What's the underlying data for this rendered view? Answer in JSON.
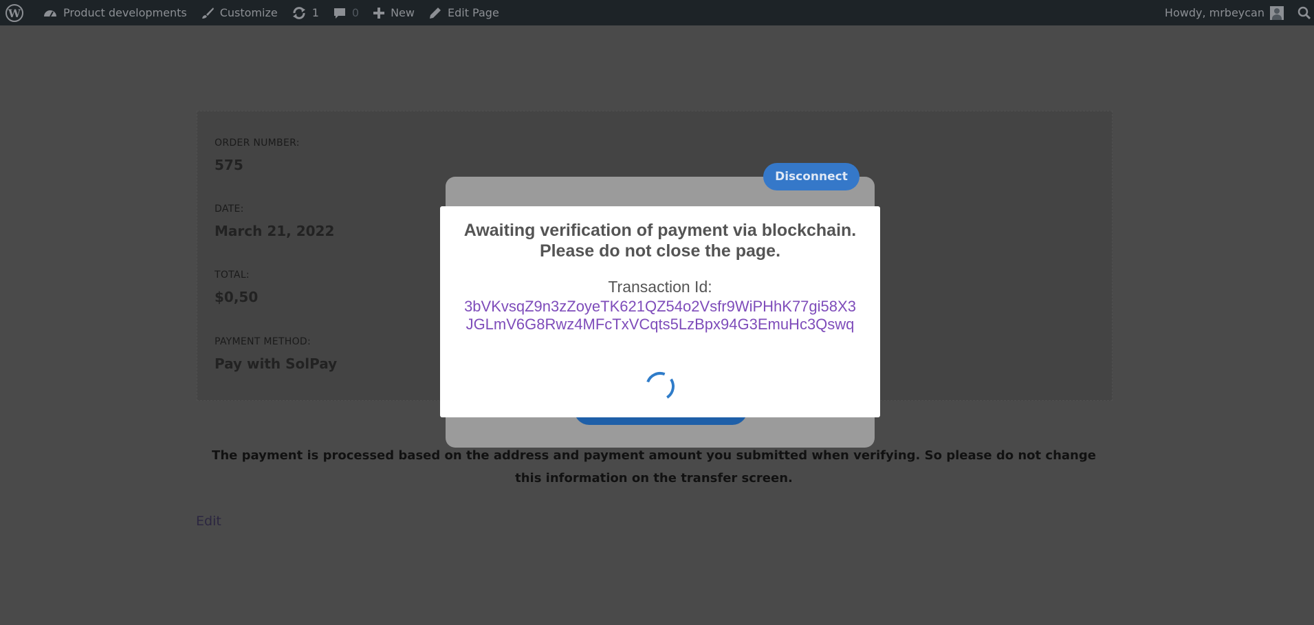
{
  "admin_bar": {
    "site_name": "Product developments",
    "customize": "Customize",
    "updates_count": "1",
    "comments_count": "0",
    "new": "New",
    "edit_page": "Edit Page",
    "howdy": "Howdy, mrbeycan"
  },
  "order": {
    "number_label": "ORDER NUMBER:",
    "number_value": "575",
    "date_label": "DATE:",
    "date_value": "March 21, 2022",
    "total_label": "TOTAL:",
    "total_value": "$0,50",
    "method_label": "PAYMENT METHOD:",
    "method_value": "Pay with SolPay"
  },
  "notice": "The payment is processed based on the address and payment amount you submitted when verifying. So please do not change this information on the transfer screen.",
  "edit_link": "Edit",
  "connect_modal": {
    "disconnect_label": "Disconnect"
  },
  "verify_modal": {
    "title": "Awaiting verification of payment via blockchain. Please do not close the page.",
    "txid_label": "Transaction Id:",
    "txid_value": "3bVKvsqZ9n3zZoyeTK621QZ54o2Vsfr9WiPHhK77gi58X3JGLmV6G8Rwz4MFcTxVCqts5LzBpx94G3EmuHc3Qswq"
  },
  "colors": {
    "admin_bar_bg": "#1d2327",
    "accent_blue": "#3578c9",
    "txid_purple": "#7e4cba",
    "overlay": "#4a4a4a"
  }
}
